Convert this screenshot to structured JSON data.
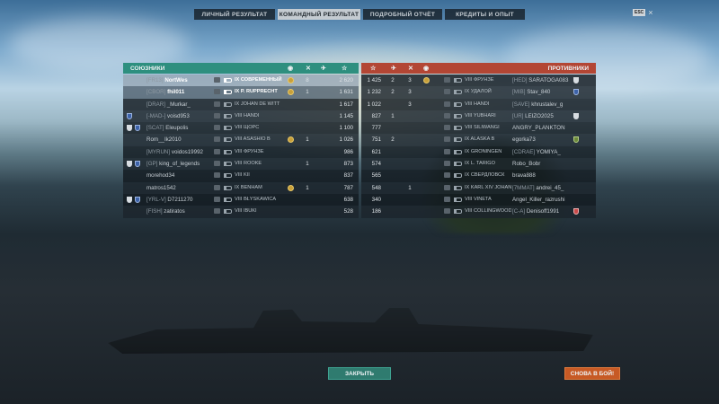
{
  "tabs": [
    {
      "label": "ЛИЧНЫЙ РЕЗУЛЬТАТ",
      "active": false
    },
    {
      "label": "КОМАНДНЫЙ РЕЗУЛЬТАТ",
      "active": true
    },
    {
      "label": "ПОДРОБНЫЙ ОТЧЁТ",
      "active": false
    },
    {
      "label": "КРЕДИТЫ И ОПЫТ",
      "active": false
    }
  ],
  "corner": {
    "hotkey": "ESC",
    "close_glyph": "×"
  },
  "allies": {
    "title": "СОЮЗНИКИ",
    "color": "#2e8f7f",
    "rows": [
      {
        "side_icon": "",
        "clan": "[FR13]",
        "name": "NortWes",
        "level": "XI",
        "ship": "IX СОВРЕМЕННЫЙ",
        "medal": true,
        "kills": "8",
        "xp": "2 620",
        "hl": "hl"
      },
      {
        "side_icon": "",
        "clan": "[CBOR]",
        "name": "fhil011",
        "level": "",
        "ship": "IX P. RUPPRECHT",
        "medal": true,
        "kills": "1",
        "xp": "1 631",
        "hl": "hl2"
      },
      {
        "side_icon": "",
        "clan": "[DRAR]",
        "name": "_Murkar_",
        "level": "",
        "ship": "IX JOHAN DE WITT",
        "medal": false,
        "kills": "",
        "xp": "1 617",
        "hl": ""
      },
      {
        "side_icon": "blue",
        "clan": "[-MAD-]",
        "name": "voisd953",
        "level": "",
        "ship": "VIII HANDI",
        "medal": false,
        "kills": "",
        "xp": "1 145",
        "hl": ""
      },
      {
        "side_icon": "both",
        "clan": "[SCAT]",
        "name": "Eleupolis",
        "level": "",
        "ship": "VIII ЩОРС",
        "medal": false,
        "kills": "",
        "xp": "1 100",
        "hl": ""
      },
      {
        "side_icon": "",
        "clan": "",
        "name": "Rom__Ik2010",
        "level": "",
        "ship": "VIII ASASHIO B",
        "medal": true,
        "kills": "1",
        "xp": "1 026",
        "hl": ""
      },
      {
        "side_icon": "",
        "clan": "[MYRUN]",
        "name": "voidos19992",
        "level": "",
        "ship": "VIII ФРУНЗЕ",
        "medal": false,
        "kills": "",
        "xp": "986",
        "hl": ""
      },
      {
        "side_icon": "both",
        "clan": "[GP]",
        "name": "king_of_legends",
        "level": "",
        "ship": "VIII ROOKE",
        "medal": false,
        "kills": "1",
        "xp": "873",
        "hl": ""
      },
      {
        "side_icon": "",
        "clan": "",
        "name": "morehod34",
        "level": "",
        "ship": "VIII KII",
        "medal": false,
        "kills": "",
        "xp": "837",
        "hl": ""
      },
      {
        "side_icon": "",
        "clan": "",
        "name": "matros1542",
        "level": "",
        "ship": "IX BENHAM",
        "medal": true,
        "kills": "1",
        "xp": "787",
        "hl": ""
      },
      {
        "side_icon": "both",
        "clan": "[YRL-V]",
        "name": "D7211270",
        "level": "",
        "ship": "VIII BŁYSKAWICA",
        "medal": false,
        "kills": "",
        "xp": "638",
        "hl": ""
      },
      {
        "side_icon": "",
        "clan": "[FISH]",
        "name": "zatiratos",
        "level": "",
        "ship": "VIII IBUKI",
        "medal": false,
        "kills": "",
        "xp": "528",
        "hl": ""
      }
    ]
  },
  "enemies": {
    "title": "ПРОТИВНИКИ",
    "color": "#b34634",
    "rows": [
      {
        "xp": "1 425",
        "kills": "3",
        "planes": "2",
        "medal": true,
        "ship": "VIII ФРУНЗЕ",
        "clan": "[HED]",
        "name": "SARATOGA083",
        "side_icon": "white"
      },
      {
        "xp": "1 232",
        "kills": "3",
        "planes": "2",
        "medal": false,
        "ship": "IX УДАЛОЙ",
        "clan": "[MIB]",
        "name": "Stav_840",
        "side_icon": "blue"
      },
      {
        "xp": "1 022",
        "kills": "3",
        "planes": "",
        "medal": false,
        "ship": "VIII HANDI",
        "clan": "[SAVE]",
        "name": "khrustalev_g",
        "side_icon": ""
      },
      {
        "xp": "827",
        "kills": "",
        "planes": "1",
        "medal": false,
        "ship": "VIII YUBHARI",
        "clan": "[UR]",
        "name": "LEIZO2025",
        "side_icon": "white"
      },
      {
        "xp": "777",
        "kills": "",
        "planes": "",
        "medal": false,
        "ship": "VIII SILIWANGI",
        "clan": "",
        "name": "ANGRY_PLANKTON",
        "side_icon": ""
      },
      {
        "xp": "751",
        "kills": "",
        "planes": "2",
        "medal": false,
        "ship": "IX ALASKA B",
        "clan": "",
        "name": "egorka73",
        "side_icon": "green"
      },
      {
        "xp": "621",
        "kills": "",
        "planes": "",
        "medal": false,
        "ship": "IX GRONINGEN",
        "clan": "[CDRAE]",
        "name": "YOMIYA_",
        "side_icon": ""
      },
      {
        "xp": "574",
        "kills": "",
        "planes": "",
        "medal": false,
        "ship": "IX L. TARIGO",
        "clan": "",
        "name": "Robo_Bobr",
        "side_icon": ""
      },
      {
        "xp": "565",
        "kills": "",
        "planes": "",
        "medal": false,
        "ship": "IX СВЕРДЛОВСК",
        "clan": "",
        "name": "brava888",
        "side_icon": ""
      },
      {
        "xp": "548",
        "kills": "1",
        "planes": "",
        "medal": false,
        "ship": "IX KARL XIV JOHAN",
        "clan": "[7MMAT]",
        "name": "andrei_45_",
        "side_icon": ""
      },
      {
        "xp": "340",
        "kills": "",
        "planes": "",
        "medal": false,
        "ship": "VIII VINETA",
        "clan": "",
        "name": "Angel_Killer_razrushi",
        "side_icon": ""
      },
      {
        "xp": "186",
        "kills": "",
        "planes": "",
        "medal": false,
        "ship": "VIII COLLINGWOOD",
        "clan": "[C-A]",
        "name": "Denisoff1991",
        "side_icon": "red"
      }
    ]
  },
  "buttons": {
    "close": "ЗАКРЫТЬ",
    "again": "СНОВА В БОЙ!"
  },
  "icons": {
    "star": "☆",
    "kills": "✕",
    "planes": "✈"
  }
}
